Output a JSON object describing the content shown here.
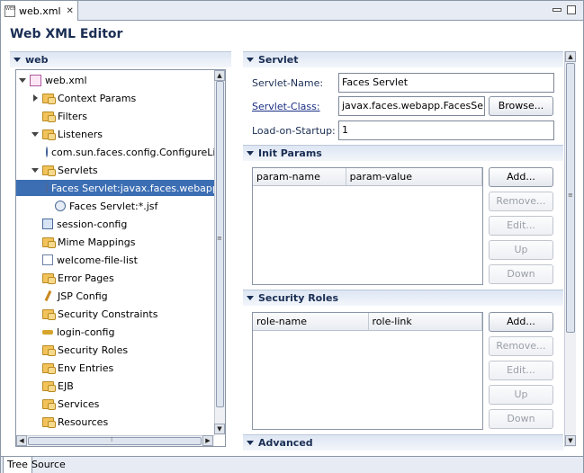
{
  "tab": {
    "title": "web.xml",
    "icon": "xml-file-icon"
  },
  "editor_title": "Web XML Editor",
  "tree_section": {
    "label": "web"
  },
  "tree": [
    {
      "label": "web.xml",
      "depth": 0,
      "expander": "open",
      "icon": "xml"
    },
    {
      "label": "Context Params",
      "depth": 1,
      "expander": "closed",
      "icon": "folder"
    },
    {
      "label": "Filters",
      "depth": 1,
      "expander": "none",
      "icon": "folder"
    },
    {
      "label": "Listeners",
      "depth": 1,
      "expander": "open",
      "icon": "folder"
    },
    {
      "label": "com.sun.faces.config.ConfigureListener",
      "depth": 2,
      "expander": "none",
      "icon": "gear"
    },
    {
      "label": "Servlets",
      "depth": 1,
      "expander": "open",
      "icon": "folder"
    },
    {
      "label": "Faces Servlet:javax.faces.webapp.FacesServlet",
      "depth": 2,
      "expander": "none",
      "icon": "servlet",
      "selected": true
    },
    {
      "label": "Faces Servlet:*.jsf",
      "depth": 2,
      "expander": "none",
      "icon": "servlet"
    },
    {
      "label": "session-config",
      "depth": 1,
      "expander": "none",
      "icon": "cfg"
    },
    {
      "label": "Mime Mappings",
      "depth": 1,
      "expander": "none",
      "icon": "folder"
    },
    {
      "label": "welcome-file-list",
      "depth": 1,
      "expander": "none",
      "icon": "list"
    },
    {
      "label": "Error Pages",
      "depth": 1,
      "expander": "none",
      "icon": "folder"
    },
    {
      "label": "JSP Config",
      "depth": 1,
      "expander": "none",
      "icon": "pen"
    },
    {
      "label": "Security Constraints",
      "depth": 1,
      "expander": "none",
      "icon": "folder"
    },
    {
      "label": "login-config",
      "depth": 1,
      "expander": "none",
      "icon": "key"
    },
    {
      "label": "Security Roles",
      "depth": 1,
      "expander": "none",
      "icon": "folder"
    },
    {
      "label": "Env Entries",
      "depth": 1,
      "expander": "none",
      "icon": "folder"
    },
    {
      "label": "EJB",
      "depth": 1,
      "expander": "none",
      "icon": "folder"
    },
    {
      "label": "Services",
      "depth": 1,
      "expander": "none",
      "icon": "folder"
    },
    {
      "label": "Resources",
      "depth": 1,
      "expander": "none",
      "icon": "folder"
    }
  ],
  "servlet": {
    "header": "Servlet",
    "name_label": "Servlet-Name:",
    "name_value": "Faces Servlet",
    "class_label": "Servlet-Class:",
    "class_value": "javax.faces.webapp.FacesServlet",
    "browse_label": "Browse...",
    "load_label": "Load-on-Startup:",
    "load_value": "1"
  },
  "init_params": {
    "header": "Init Params",
    "columns": [
      "param-name",
      "param-value"
    ],
    "buttons": {
      "add": "Add...",
      "remove": "Remove...",
      "edit": "Edit...",
      "up": "Up",
      "down": "Down"
    }
  },
  "security_roles": {
    "header": "Security Roles",
    "columns": [
      "role-name",
      "role-link"
    ],
    "buttons": {
      "add": "Add...",
      "remove": "Remove...",
      "edit": "Edit...",
      "up": "Up",
      "down": "Down"
    }
  },
  "advanced": {
    "header": "Advanced"
  },
  "bottom_tabs": {
    "tree": "Tree",
    "source": "Source"
  }
}
